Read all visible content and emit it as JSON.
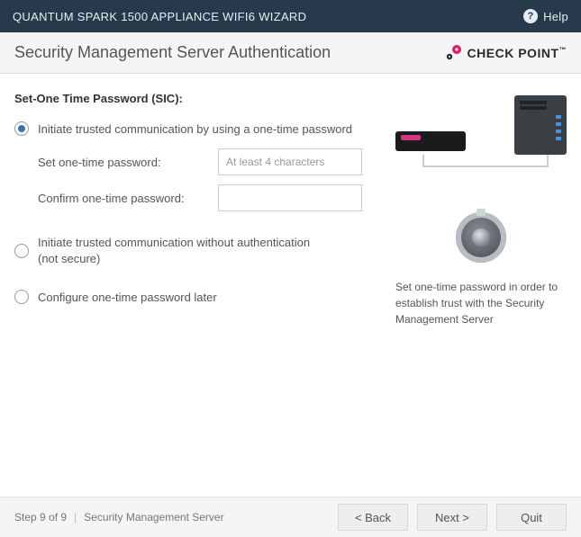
{
  "titlebar": {
    "title": "QUANTUM SPARK 1500 APPLIANCE WIFI6 WIZARD",
    "help_label": "Help"
  },
  "subheader": {
    "heading": "Security Management Server Authentication",
    "brand": "CHECK POINT"
  },
  "form": {
    "section_title": "Set-One Time Password (SIC):",
    "option1": {
      "label": "Initiate trusted communication by using a one-time password",
      "selected": true,
      "set_password_label": "Set one-time password:",
      "set_password_placeholder": "At least 4 characters",
      "confirm_password_label": "Confirm one-time password:"
    },
    "option2": {
      "label": "Initiate trusted communication without authentication (not secure)",
      "selected": false
    },
    "option3": {
      "label": "Configure one-time password later",
      "selected": false
    }
  },
  "right_panel": {
    "hint": "Set one-time password in order to establish trust with the Security Management Server"
  },
  "footer": {
    "step_text": "Step 9 of 9",
    "page_name": "Security Management Server",
    "back": "< Back",
    "next": "Next >",
    "quit": "Quit"
  },
  "colors": {
    "brand_pink": "#e31b6d",
    "titlebar_bg": "#273a4b"
  }
}
